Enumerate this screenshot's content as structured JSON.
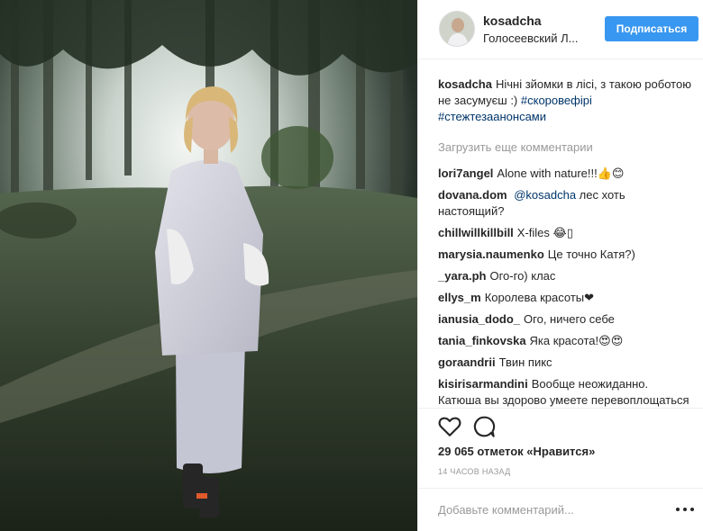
{
  "post": {
    "photo_alt": "post-photo",
    "author": {
      "username": "kosadcha",
      "location": "Голосеевский Л...",
      "follow_label": "Подписаться"
    },
    "caption": {
      "username": "kosadcha",
      "text": "Нічні зйомки в лісі, з такою роботою не засумуєш :) ",
      "hashtags": [
        "#скоровефірі",
        "#стежтезаанонсами"
      ]
    },
    "load_more": "Загрузить еще комментарии",
    "comments": [
      {
        "username": "lori7angel",
        "text": "Alone with nature!!!👍😊"
      },
      {
        "username": "dovana.dom",
        "mention": "@kosadcha",
        "text": " лес хоть настоящий?"
      },
      {
        "username": "chillwillkillbill",
        "text": "X-files 😂▯"
      },
      {
        "username": "marysia.naumenko",
        "text": "Це точно Катя?)"
      },
      {
        "username": "_yara.ph",
        "text": "Ого-го) клас"
      },
      {
        "username": "ellys_m",
        "text": "Королева красоты❤"
      },
      {
        "username": "ianusia_dodo_",
        "text": "Ого, ничего себе"
      },
      {
        "username": "tania_finkovska",
        "text": "Яка красота!😍😍"
      },
      {
        "username": "goraandrii",
        "text": "Твин пикс"
      },
      {
        "username": "kisirisarmandini",
        "text": "Вообще неожиданно. Катюша вы здорово умеете перевоплощаться 😍"
      }
    ],
    "actions": {
      "like_icon": "heart-icon",
      "comment_icon": "comment-icon"
    },
    "likes": "29 065 отметок «Нравится»",
    "timestamp": "14 часов назад",
    "add_comment_placeholder": "Добавьте комментарий...",
    "more_icon": "more-options-icon"
  },
  "colors": {
    "follow": "#3897f0",
    "hashtag": "#003569",
    "muted": "#999999",
    "border": "#efefef"
  }
}
